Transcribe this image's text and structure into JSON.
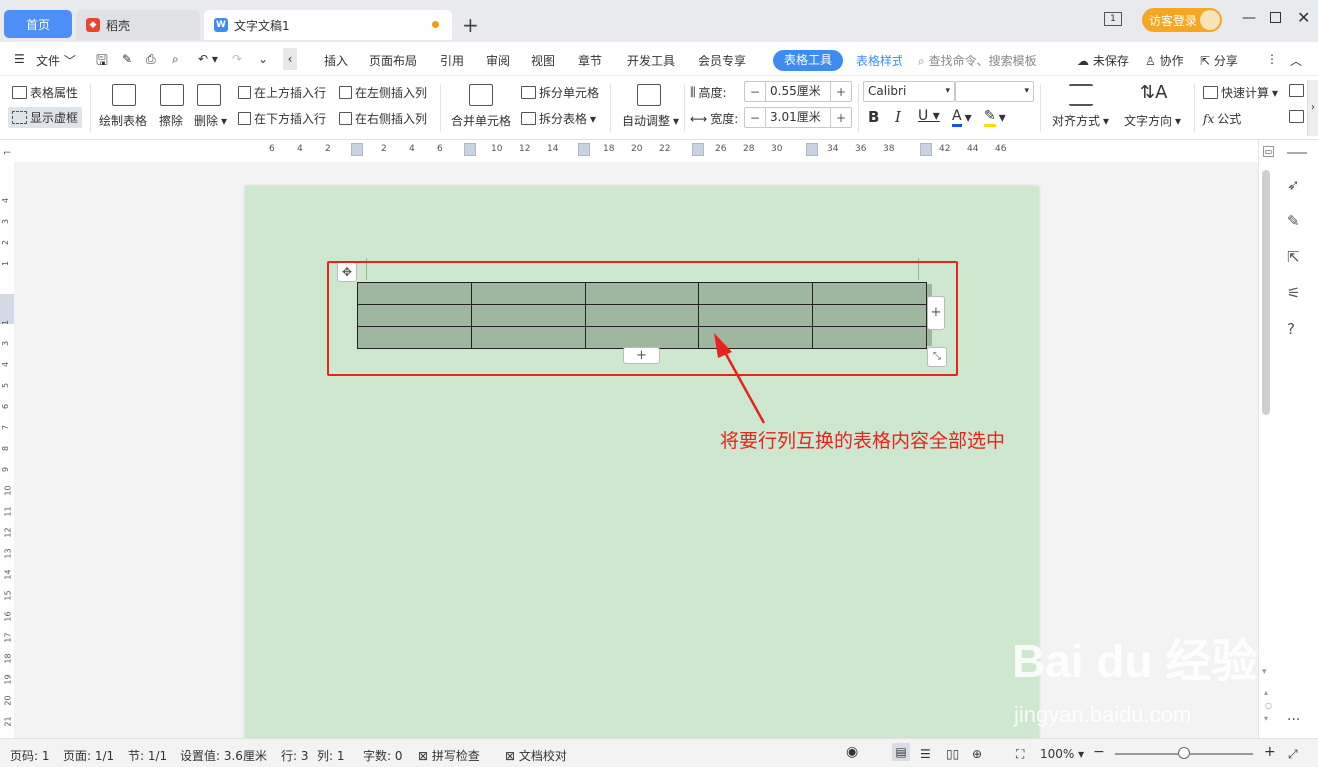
{
  "titlebar": {
    "tabs": [
      {
        "label": "首页"
      },
      {
        "label": "稻壳"
      },
      {
        "label": "文字文稿1"
      }
    ],
    "new_tab_label": "+",
    "page_count_badge": "1",
    "login_label": "访客登录"
  },
  "menu": {
    "file_label": "文件",
    "items": [
      "插入",
      "页面布局",
      "引用",
      "审阅",
      "视图",
      "章节",
      "开发工具",
      "会员专享"
    ],
    "table_tools_label": "表格工具",
    "table_style_label": "表格样式",
    "search_placeholder": "查找命令、搜索模板",
    "unsaved_label": "未保存",
    "collab_label": "协作",
    "share_label": "分享"
  },
  "ribbon": {
    "table_props": "表格属性",
    "show_gridlines": "显示虚框",
    "draw_table": "绘制表格",
    "erase": "擦除",
    "delete": "删除",
    "insert_above": "在上方插入行",
    "insert_below": "在下方插入行",
    "insert_left": "在左侧插入列",
    "insert_right": "在右侧插入列",
    "merge_cells": "合并单元格",
    "split_cells": "拆分单元格",
    "split_table": "拆分表格",
    "auto_fit": "自动调整",
    "height_label": "高度:",
    "height_value": "0.55厘米",
    "width_label": "宽度:",
    "width_value": "3.01厘米",
    "font_name": "Calibri",
    "align_label": "对齐方式",
    "text_dir_label": "文字方向",
    "quick_calc": "快速计算",
    "formula": "公式"
  },
  "ruler": {
    "ticks": [
      "6",
      "4",
      "2",
      "2",
      "4",
      "6",
      "10",
      "12",
      "14",
      "18",
      "20",
      "22",
      "26",
      "28",
      "30",
      "34",
      "36",
      "38",
      "42",
      "44",
      "46"
    ],
    "vticks": [
      "4",
      "3",
      "2",
      "1",
      "1",
      "3",
      "4",
      "5",
      "6",
      "7",
      "8",
      "9",
      "10",
      "11",
      "12",
      "13",
      "14",
      "15",
      "16",
      "17",
      "18",
      "19",
      "20",
      "21"
    ]
  },
  "document": {
    "table": {
      "rows": 3,
      "cols": 5
    },
    "annotation": "将要行列互换的表格内容全部选中",
    "watermark": "Bai du 经验",
    "watermark_url": "jingyan.baidu.com"
  },
  "status": {
    "page_no": "页码: 1",
    "pages": "页面: 1/1",
    "section": "节: 1/1",
    "setting": "设置值: 3.6厘米",
    "row": "行: 3",
    "col": "列: 1",
    "words": "字数: 0",
    "spell": "拼写检查",
    "proof": "文档校对",
    "zoom": "100%"
  },
  "colors": {
    "accent": "#3d8cf2",
    "page_bg": "#cde8cf",
    "table_fill": "#9fb79f",
    "annotation": "#e8231d",
    "login": "#f5a623"
  }
}
